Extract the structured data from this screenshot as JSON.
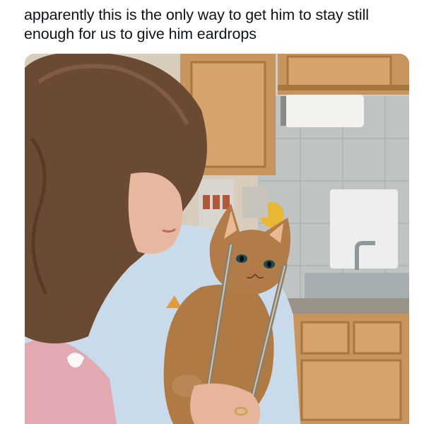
{
  "post": {
    "caption": "apparently this is the only way to get him to stay still enough for us to give him eardrops"
  },
  "media": {
    "alt_icon": "photo-icon"
  },
  "colors": {
    "background": "#ffffff",
    "text": "#0f1419",
    "cabinet": "#c8955e",
    "tile": "#bcc0bf",
    "hair": "#6b4a33",
    "sweater": "#bcd6ec",
    "cat": "#b07a45"
  }
}
